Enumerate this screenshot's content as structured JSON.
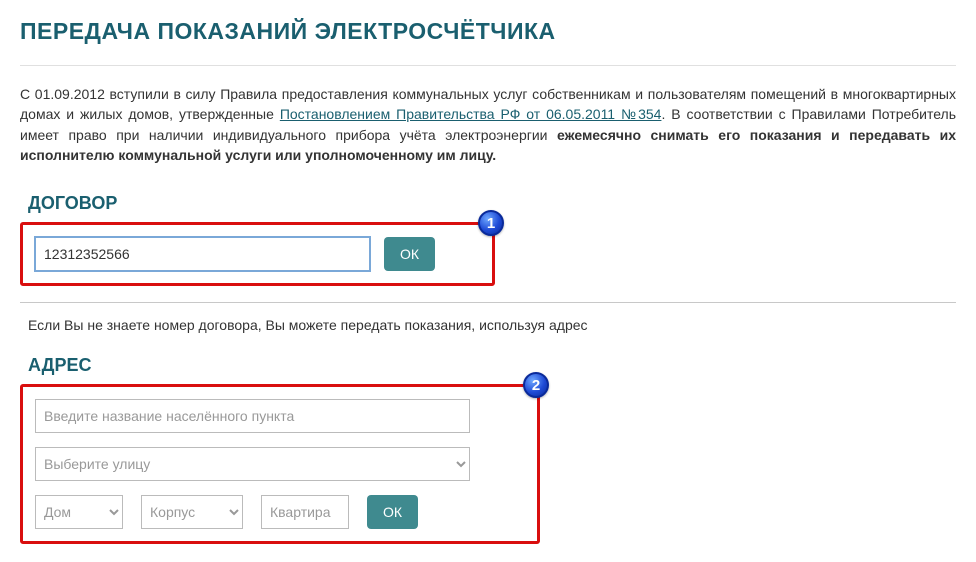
{
  "page_title": "ПЕРЕДАЧА ПОКАЗАНИЙ ЭЛЕКТРОСЧЁТЧИКА",
  "intro": {
    "prefix": "С 01.09.2012 вступили в силу Правила предоставления коммунальных услуг собственникам и пользователям помещений в многоквартирных домах и жилых домов, утвержденные ",
    "link_text": "Постановлением Правительства РФ от 06.05.2011 №354",
    "middle": ". В соответствии с Правилами Потребитель имеет право при наличии индивидуального прибора учёта электроэнергии ",
    "bold": "ежемесячно снимать его показания и передавать их исполнителю коммунальной услуги или уполномоченному им лицу."
  },
  "contract": {
    "heading": "ДОГОВОР",
    "value": "12312352566",
    "ok_label": "ОК",
    "badge": "1"
  },
  "hint": "Если Вы не знаете номер договора, Вы можете передать показания, используя адрес",
  "address": {
    "heading": "АДРЕС",
    "badge": "2",
    "locality_placeholder": "Введите название населённого пункта",
    "street_placeholder": "Выберите улицу",
    "house_placeholder": "Дом",
    "corp_placeholder": "Корпус",
    "flat_placeholder": "Квартира",
    "ok_label": "ОК"
  }
}
